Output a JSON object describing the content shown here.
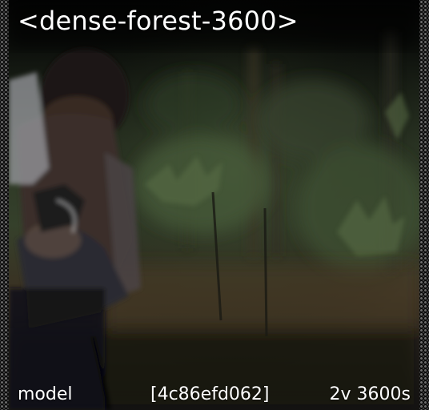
{
  "overlay": {
    "title": "<dense-forest-3600>",
    "footer_left": "model",
    "footer_center": "[4c86efd062]",
    "footer_right": "2v 3600s"
  },
  "scene": {
    "description_icon": "forest-photo",
    "colors": {
      "top": "#050505",
      "foliage": "#3c4a2c",
      "ground": "#3b2e22",
      "bottom": "#151310"
    }
  }
}
